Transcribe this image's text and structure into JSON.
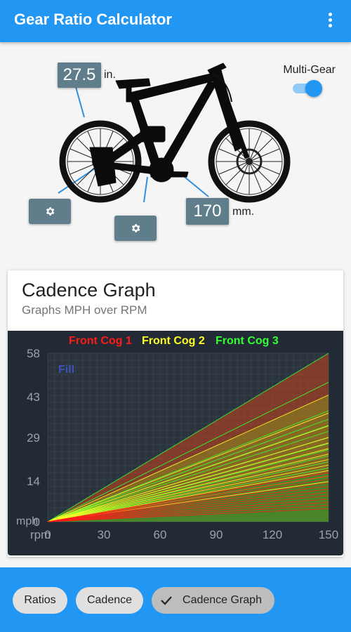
{
  "appbar": {
    "title": "Gear Ratio Calculator",
    "menu_icon": "more-vert-icon"
  },
  "bike": {
    "wheel_size": "27.5",
    "wheel_unit": "in.",
    "crank_length": "170",
    "crank_unit": "mm.",
    "rear_settings_icon": "gear-icon",
    "front_settings_icon": "gear-icon"
  },
  "multi_gear": {
    "label": "Multi-Gear",
    "enabled": true
  },
  "card": {
    "title": "Cadence Graph",
    "subtitle": "Graphs MPH over RPM"
  },
  "chart_data": {
    "type": "line",
    "title": "",
    "legend": [
      {
        "name": "Front Cog 1",
        "color": "#ff1a1a"
      },
      {
        "name": "Front Cog 2",
        "color": "#ffff26"
      },
      {
        "name": "Front Cog 3",
        "color": "#33ff33"
      }
    ],
    "legend_position": "top",
    "fill_label": "Fill",
    "xlabel": "rpm",
    "ylabel": "mph",
    "xlim": [
      0,
      150
    ],
    "ylim": [
      0,
      58
    ],
    "x_ticks": [
      "0",
      "30",
      "60",
      "90",
      "120",
      "150"
    ],
    "y_ticks": [
      "0",
      "14",
      "29",
      "43",
      "58"
    ],
    "grid": true,
    "filled": true,
    "series": [
      {
        "color": "#ff1a1a",
        "mph_at_150": [
          4.5,
          5.6,
          6.7,
          7.8,
          9.0,
          10.1,
          11.2,
          12.3,
          13.4,
          14.6,
          15.7,
          16.8
        ]
      },
      {
        "color": "#ffff26",
        "mph_at_150": [
          13.8,
          15.7,
          17.6,
          19.5,
          21.4,
          23.3,
          25.2,
          27.1,
          29.0,
          33.0,
          37.4,
          43.6
        ]
      },
      {
        "color": "#33ff33",
        "mph_at_150": [
          18.5,
          20.6,
          22.7,
          24.8,
          26.9,
          29.0,
          31.1,
          33.2,
          35.3,
          38.2,
          48.0,
          58.0
        ]
      }
    ]
  },
  "tabs": [
    {
      "label": "Ratios",
      "selected": false
    },
    {
      "label": "Cadence",
      "selected": false
    },
    {
      "label": "Cadence Graph",
      "selected": true
    }
  ]
}
